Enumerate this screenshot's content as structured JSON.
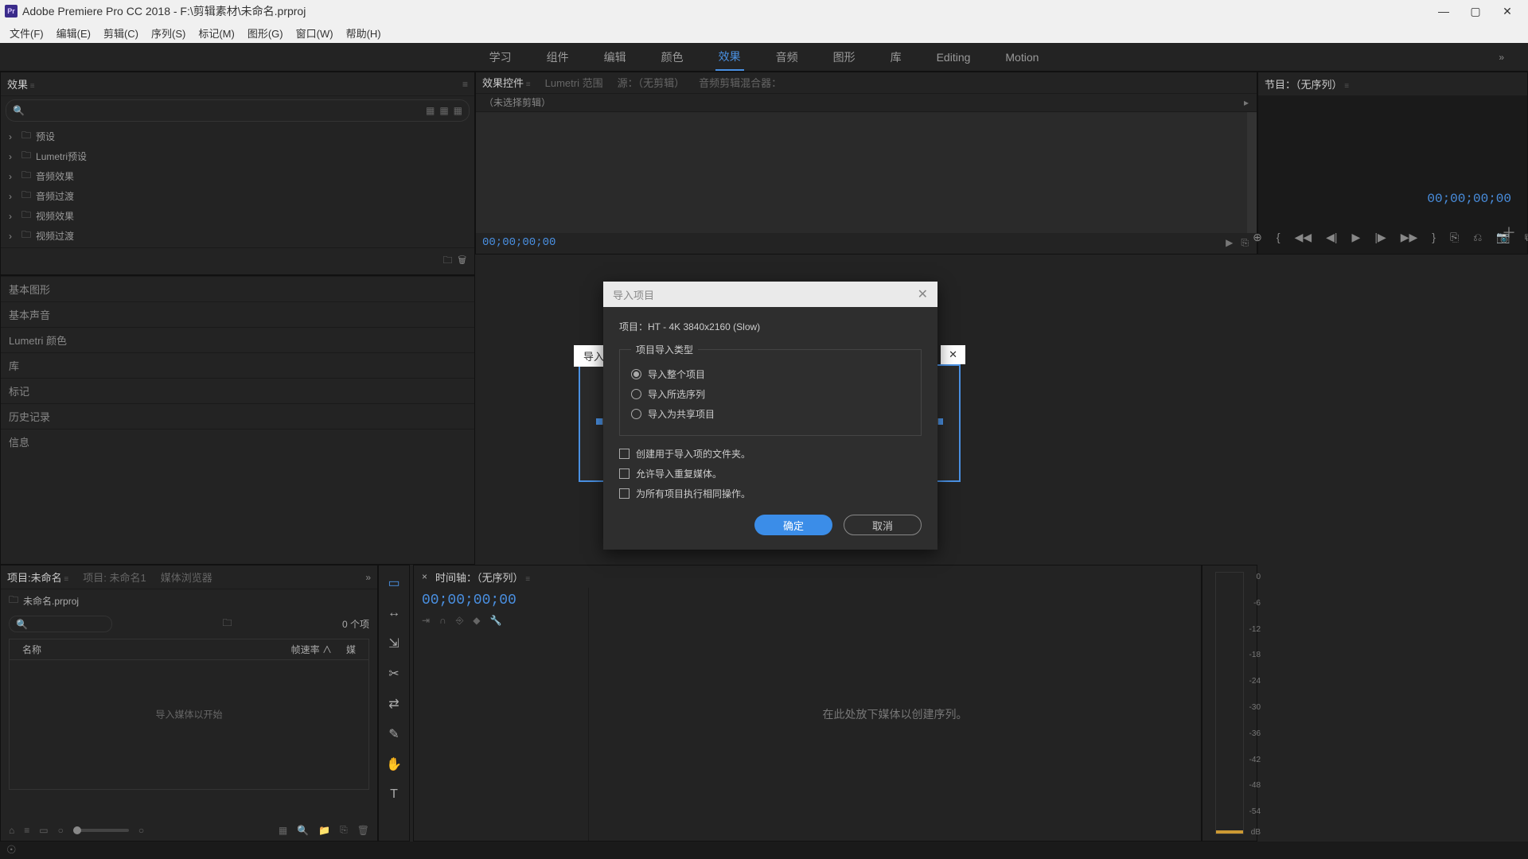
{
  "titlebar": {
    "app_icon_text": "Pr",
    "title": "Adobe Premiere Pro CC 2018 - F:\\剪辑素材\\未命名.prproj"
  },
  "menubar": [
    "文件(F)",
    "编辑(E)",
    "剪辑(C)",
    "序列(S)",
    "标记(M)",
    "图形(G)",
    "窗口(W)",
    "帮助(H)"
  ],
  "workspaces": {
    "items": [
      "学习",
      "组件",
      "编辑",
      "颜色",
      "效果",
      "音频",
      "图形",
      "库",
      "Editing",
      "Motion"
    ],
    "active_index": 4,
    "more_glyph": "»"
  },
  "panel_effect_controls": {
    "tabs": [
      "效果控件",
      "Lumetri 范围",
      "源：（无剪辑）",
      "音频剪辑混合器："
    ],
    "selector_text": "（未选择剪辑）",
    "selector_arrow": "▸",
    "timecode": "00;00;00;00"
  },
  "panel_program": {
    "tab": "节目：（无序列）",
    "tc_right": "00;00;00;00",
    "transport_icons": [
      "⊕",
      "{",
      "◀◀",
      "◀|",
      "▶",
      "|▶",
      "▶▶",
      "}",
      "⎘",
      "⎌",
      "📷",
      "⧉"
    ],
    "add_glyph": "＋"
  },
  "hidden_dialog": {
    "tab": "导入",
    "close": "✕"
  },
  "effects_panel": {
    "tab": "效果",
    "search_icon": "🔍",
    "tree": [
      "预设",
      "Lumetri预设",
      "音频效果",
      "音频过渡",
      "视频效果",
      "视频过渡"
    ],
    "bottom_icons": [
      "🗀",
      "🗑"
    ]
  },
  "right_sections": [
    "基本图形",
    "基本声音",
    "Lumetri 颜色",
    "库",
    "标记",
    "历史记录",
    "信息"
  ],
  "project_panel": {
    "tabs": [
      "项目:未命名",
      "项目: 未命名1",
      "媒体浏览器"
    ],
    "more": "»",
    "bin_name": "未命名.prproj",
    "item_count": "0 个项",
    "columns": [
      "名称",
      "帧速率 ∧",
      "媒"
    ],
    "empty_text": "导入媒体以开始",
    "footer_icons_left": [
      "⌂",
      "≡",
      "▭",
      "○"
    ],
    "footer_icons_right": [
      "○",
      "▦",
      "🔍",
      "📁",
      "⎘",
      "🗑"
    ]
  },
  "toolstrip": [
    "▭",
    "↔",
    "⇲",
    "✂",
    "⇄",
    "✎",
    "✋",
    "T"
  ],
  "timeline": {
    "close_x": "×",
    "tab": "时间轴：（无序列）",
    "tc": "00;00;00;00",
    "icons": [
      "⇥",
      "∩",
      "⎆",
      "◆",
      "🔧"
    ],
    "drop_text": "在此处放下媒体以创建序列。"
  },
  "audiometer": {
    "ticks": [
      "0",
      "-6",
      "-12",
      "-18",
      "-24",
      "-30",
      "-36",
      "-42",
      "-48",
      "-54",
      "dB"
    ]
  },
  "statusbar_icon": "☉",
  "modal": {
    "title": "导入项目",
    "close": "✕",
    "project_line": "项目：HT - 4K 3840x2160 (Slow)",
    "fieldset_legend": "项目导入类型",
    "radios": [
      {
        "label": "导入整个项目",
        "checked": true
      },
      {
        "label": "导入所选序列",
        "checked": false
      },
      {
        "label": "导入为共享项目",
        "checked": false
      }
    ],
    "checks": [
      "创建用于导入项的文件夹。",
      "允许导入重复媒体。",
      "为所有项目执行相同操作。"
    ],
    "ok": "确定",
    "cancel": "取消"
  }
}
